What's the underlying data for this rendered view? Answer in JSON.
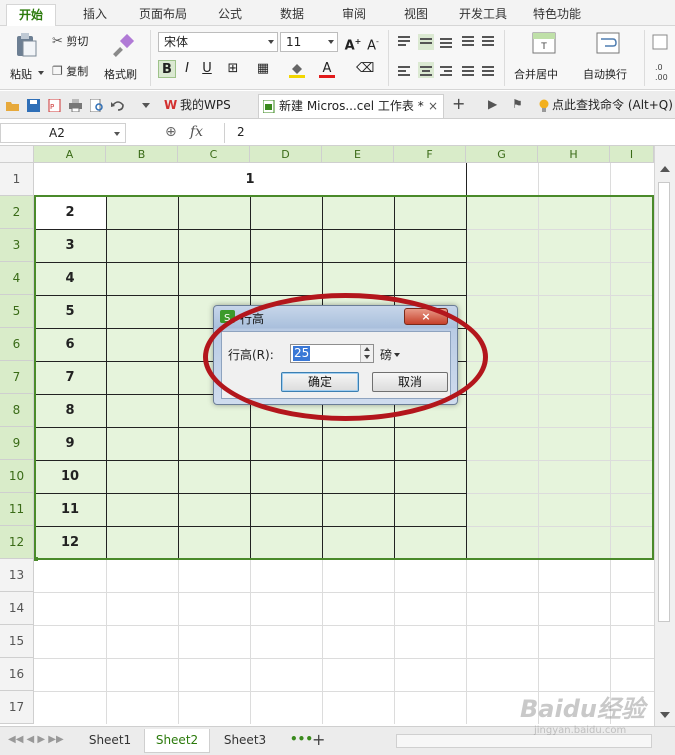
{
  "ribbon_tabs": [
    "开始",
    "插入",
    "页面布局",
    "公式",
    "数据",
    "审阅",
    "视图",
    "开发工具",
    "特色功能"
  ],
  "clipboard": {
    "paste": "粘贴",
    "cut": "剪切",
    "copy": "复制",
    "format_painter": "格式刷"
  },
  "font": {
    "name": "宋体",
    "size": "11"
  },
  "alignment": {
    "merge_center": "合并居中",
    "wrap_text": "自动换行"
  },
  "doc_tabs": {
    "mywps": "我的WPS",
    "workbook": "新建 Micros...cel 工作表 *"
  },
  "search_command": "点此查找命令 (Alt+Q)",
  "formula_bar": {
    "name_box": "A2",
    "fx": "fx",
    "value": "2"
  },
  "columns": [
    "A",
    "B",
    "C",
    "D",
    "E",
    "F",
    "G",
    "H",
    "I"
  ],
  "rows": [
    "1",
    "2",
    "3",
    "4",
    "5",
    "6",
    "7",
    "8",
    "9",
    "10",
    "11",
    "12",
    "13",
    "14",
    "15",
    "16",
    "17"
  ],
  "cells": {
    "merged_row1": "1",
    "col_a": [
      "2",
      "3",
      "4",
      "5",
      "6",
      "7",
      "8",
      "9",
      "10",
      "11",
      "12"
    ]
  },
  "dialog": {
    "title": "行高",
    "label": "行高(R):",
    "value": "25",
    "unit": "磅",
    "ok": "确定",
    "cancel": "取消"
  },
  "sheets": [
    "Sheet1",
    "Sheet2",
    "Sheet3"
  ],
  "active_sheet": "Sheet2",
  "watermark": "Baidu经验",
  "watermark_url": "jingyan.baidu.com",
  "colors": {
    "accent_green": "#2b7a0b",
    "selection_fill": "#e6f4dc",
    "highlight_oval": "#b3161c"
  }
}
